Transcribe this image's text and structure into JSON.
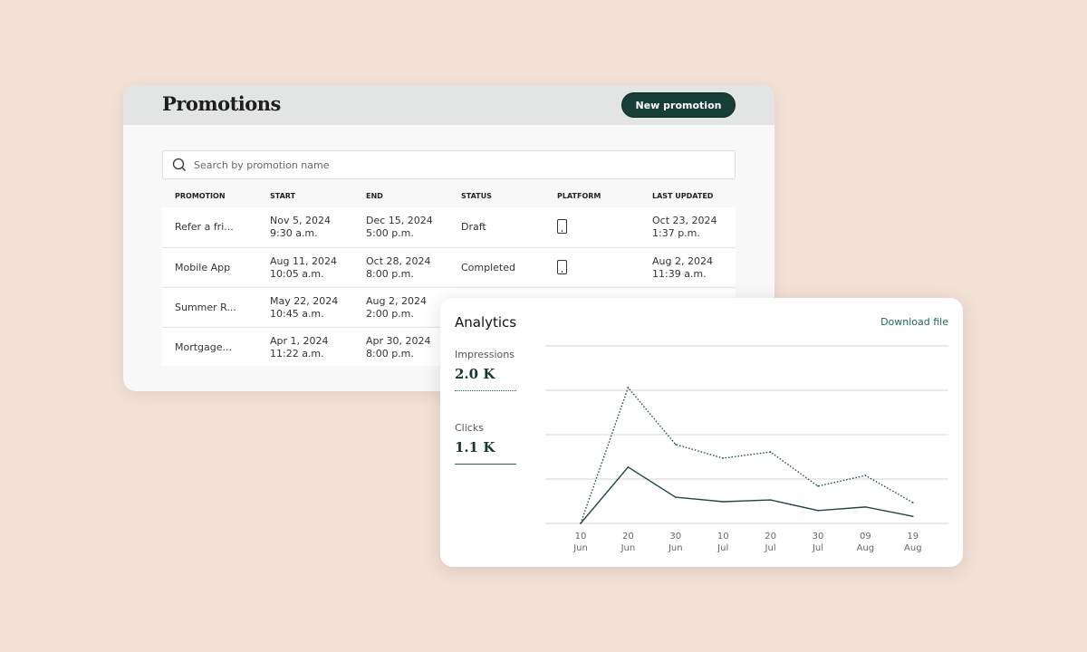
{
  "promotions": {
    "title": "Promotions",
    "new_button": "New promotion",
    "search_placeholder": "Search by promotion name",
    "columns": [
      "PROMOTION",
      "START",
      "END",
      "STATUS",
      "PLATFORM",
      "LAST UPDATED"
    ],
    "rows": [
      {
        "name": "Refer a fri...",
        "start_date": "Nov 5, 2024",
        "start_time": "9:30 a.m.",
        "end_date": "Dec 15, 2024",
        "end_time": "5:00 p.m.",
        "status": "Draft",
        "platform": "mobile-icon",
        "updated_date": "Oct 23, 2024",
        "updated_time": "1:37 p.m."
      },
      {
        "name": "Mobile App",
        "start_date": "Aug 11, 2024",
        "start_time": "10:05 a.m.",
        "end_date": "Oct 28, 2024",
        "end_time": "8:00 p.m.",
        "status": "Completed",
        "platform": "mobile-icon",
        "updated_date": "Aug 2, 2024",
        "updated_time": "11:39 a.m."
      },
      {
        "name": "Summer R...",
        "start_date": "May 22, 2024",
        "start_time": "10:45 a.m.",
        "end_date": "Aug 2, 2024",
        "end_time": "2:00 p.m."
      },
      {
        "name": "Mortgage...",
        "start_date": "Apr 1, 2024",
        "start_time": "11:22 a.m.",
        "end_date": "Apr 30, 2024",
        "end_time": "8:00 p.m."
      }
    ]
  },
  "analytics": {
    "title": "Analytics",
    "download": "Download file",
    "impressions_label": "Impressions",
    "impressions_value": "2.0 K",
    "clicks_label": "Clicks",
    "clicks_value": "1.1 K",
    "accent": "#1b3d33"
  },
  "chart_data": {
    "type": "line",
    "categories": [
      [
        "10",
        "Jun"
      ],
      [
        "20",
        "Jun"
      ],
      [
        "30",
        "Jun"
      ],
      [
        "10",
        "Jul"
      ],
      [
        "20",
        "Jul"
      ],
      [
        "30",
        "Jul"
      ],
      [
        "09",
        "Aug"
      ],
      [
        "19",
        "Aug"
      ]
    ],
    "series": [
      {
        "name": "Impressions",
        "style": "dotted",
        "values": [
          0,
          3.06,
          1.78,
          1.47,
          1.61,
          0.84,
          1.08,
          0.47
        ]
      },
      {
        "name": "Clicks",
        "style": "solid",
        "values": [
          0,
          1.27,
          0.59,
          0.49,
          0.53,
          0.29,
          0.37,
          0.16
        ]
      }
    ],
    "ylim": [
      0,
      4
    ],
    "grid": true,
    "legend": "left"
  }
}
